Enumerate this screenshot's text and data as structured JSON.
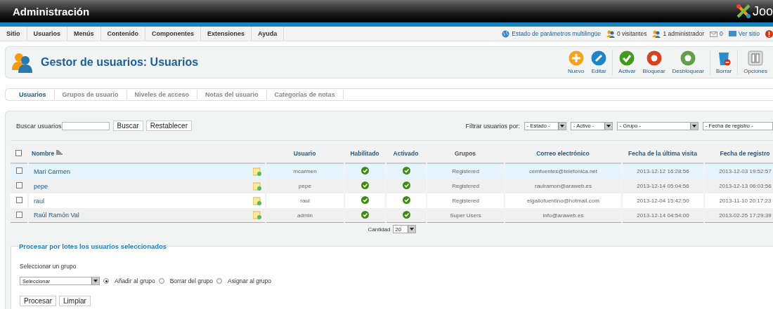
{
  "header": {
    "title": "Administración",
    "logo_text": "Joo"
  },
  "menu": [
    "Sitio",
    "Usuarios",
    "Menús",
    "Contenido",
    "Componentes",
    "Extensiones",
    "Ayuda"
  ],
  "status": [
    {
      "kind": "globe",
      "label": "Estado de parámetros multilingüe"
    },
    {
      "kind": "visitors",
      "label": "0 visitantes"
    },
    {
      "kind": "admin",
      "label": "1 administrador"
    },
    {
      "kind": "messages",
      "label": "0"
    },
    {
      "kind": "site",
      "label": "Ver sitio"
    },
    {
      "kind": "logout"
    }
  ],
  "page_title": "Gestor de usuarios: Usuarios",
  "toolbar": [
    [
      {
        "kind": "new",
        "label": "Nuevo"
      },
      {
        "kind": "edit",
        "label": "Editar"
      }
    ],
    [
      {
        "kind": "activate",
        "label": "Activar"
      },
      {
        "kind": "block",
        "label": "Bloquear"
      },
      {
        "kind": "unblock",
        "label": "Desbloquear"
      }
    ],
    [
      {
        "kind": "delete",
        "label": "Borrar"
      }
    ],
    [
      {
        "kind": "options",
        "label": "Opciones"
      }
    ]
  ],
  "tabs": [
    {
      "label": "Usuarios",
      "selected": true
    },
    {
      "label": "Grupos de usuario",
      "selected": false
    },
    {
      "label": "Niveles de acceso",
      "selected": false
    },
    {
      "label": "Notas del usuario",
      "selected": false
    },
    {
      "label": "Categorías de notas",
      "selected": false
    }
  ],
  "search": {
    "label": "Buscar usuarios",
    "buttons": [
      "Buscar",
      "Restablecer"
    ]
  },
  "filters": {
    "label": "Filtrar usuarios por:",
    "selects": [
      {
        "value": "- Estado -"
      },
      {
        "value": "- Activo -"
      },
      {
        "value": "- Grupo -"
      },
      {
        "value": "- Fecha de registro -"
      }
    ]
  },
  "table": {
    "select_all": false,
    "columns": [
      {
        "label": "Nombre",
        "sorted": true,
        "link": true
      },
      {
        "label": "Usuario",
        "sorted": false,
        "link": true
      },
      {
        "label": "Habilitado",
        "sorted": false,
        "link": true
      },
      {
        "label": "Activado",
        "sorted": false,
        "link": true
      },
      {
        "label": "Grupos",
        "sorted": false,
        "link": false
      },
      {
        "label": "Correo electrónico",
        "sorted": false,
        "link": true
      },
      {
        "label": "Fecha de la última visita",
        "sorted": false,
        "link": true
      },
      {
        "label": "Fecha de registro",
        "sorted": false,
        "link": true
      }
    ],
    "rows": [
      {
        "checked": false,
        "highlighted": true,
        "name": "Mari Carmen",
        "username": "mcarmen",
        "enabled": true,
        "activated": true,
        "groups": "Registered",
        "email": "cemfuentes@telefonica.net",
        "last_visit": "2013-12-12 16:28:56",
        "registered": "2013-12-03 19:52:57"
      },
      {
        "checked": false,
        "highlighted": false,
        "name": "pepe",
        "username": "pepe",
        "enabled": true,
        "activated": true,
        "groups": "Registered",
        "email": "raulramon@araweb.es",
        "last_visit": "2013-12-14 05:04:56",
        "registered": "2013-12-13 06:03:56"
      },
      {
        "checked": false,
        "highlighted": false,
        "name": "raul",
        "username": "raul",
        "enabled": true,
        "activated": true,
        "groups": "Registered",
        "email": "elgallofuentino@hotmail.com",
        "last_visit": "2013-12-04 15:42:50",
        "registered": "2013-11-10 20:17:23"
      },
      {
        "checked": false,
        "highlighted": false,
        "name": "Raúl Ramón Val",
        "username": "admin",
        "enabled": true,
        "activated": true,
        "groups": "Super Users",
        "email": "info@araweb.es",
        "last_visit": "2013-12-14 04:54:00",
        "registered": "2013-02-25 17:29:39"
      }
    ]
  },
  "pagination": {
    "label": "Cantidad",
    "value": "20"
  },
  "batch": {
    "legend": "Procesar por lotes los usuarios seleccionados",
    "group_label": "Seleccionar un grupo",
    "group_select": "Seleccionar",
    "options": [
      {
        "label": "Añadir al grupo",
        "selected": true
      },
      {
        "label": "Borrar del grupo",
        "selected": false
      },
      {
        "label": "Asignar al grupo",
        "selected": false
      }
    ],
    "buttons": [
      "Procesar",
      "Limpiar"
    ]
  }
}
